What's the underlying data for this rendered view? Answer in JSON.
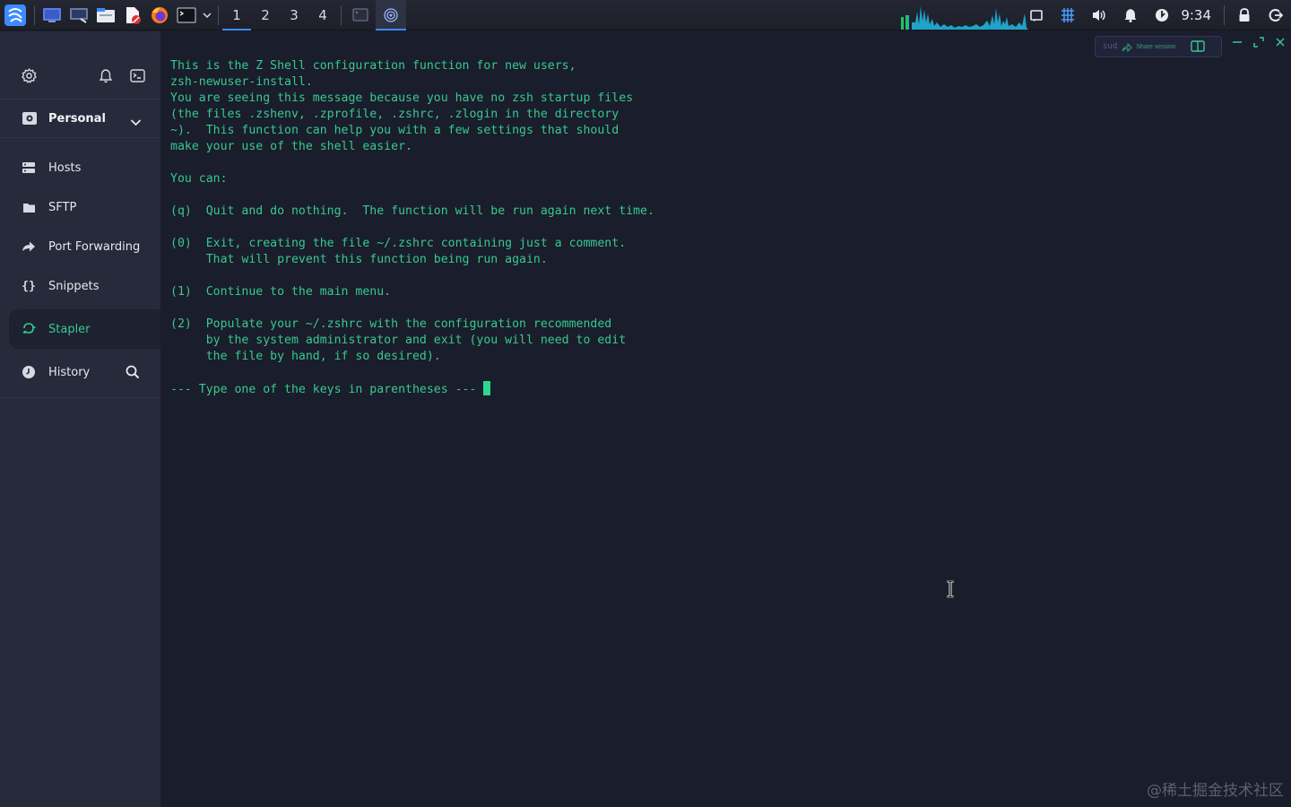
{
  "taskbar": {
    "launchers": [
      "start-menu-icon",
      "show-desktop-icon",
      "display-icon",
      "file-manager-icon",
      "document-icon",
      "firefox-icon",
      "terminal-icon"
    ],
    "workspaces": [
      "1",
      "2",
      "3",
      "4"
    ],
    "active_workspace": "1",
    "clock": "9:34",
    "accent": "#3d8bff"
  },
  "sidebar": {
    "vault": {
      "label": "Personal",
      "icon": "vault-icon"
    },
    "items": [
      {
        "label": "Hosts",
        "icon": "hosts-icon"
      },
      {
        "label": "SFTP",
        "icon": "folder-icon"
      },
      {
        "label": "Port Forwarding",
        "icon": "port-forwarding-icon"
      },
      {
        "label": "Snippets",
        "icon": "braces-icon"
      },
      {
        "label": "Stapler",
        "icon": "stapler-icon",
        "active": true
      },
      {
        "label": "History",
        "icon": "clock-icon"
      }
    ],
    "accent": "#37c98f"
  },
  "terminal": {
    "toolbar": {
      "sudo_label": "sud",
      "share_label": "Share session"
    },
    "lines": [
      "This is the Z Shell configuration function for new users,",
      "zsh-newuser-install.",
      "You are seeing this message because you have no zsh startup files",
      "(the files .zshenv, .zprofile, .zshrc, .zlogin in the directory",
      "~).  This function can help you with a few settings that should",
      "make your use of the shell easier.",
      "",
      "You can:",
      "",
      "(q)  Quit and do nothing.  The function will be run again next time.",
      "",
      "(0)  Exit, creating the file ~/.zshrc containing just a comment.",
      "     That will prevent this function being run again.",
      "",
      "(1)  Continue to the main menu.",
      "",
      "(2)  Populate your ~/.zshrc with the configuration recommended",
      "     by the system administrator and exit (you will need to edit",
      "     the file by hand, if so desired).",
      "",
      "--- Type one of the keys in parentheses --- "
    ],
    "text_color": "#37c98f"
  },
  "watermark": "@稀土掘金技术社区"
}
